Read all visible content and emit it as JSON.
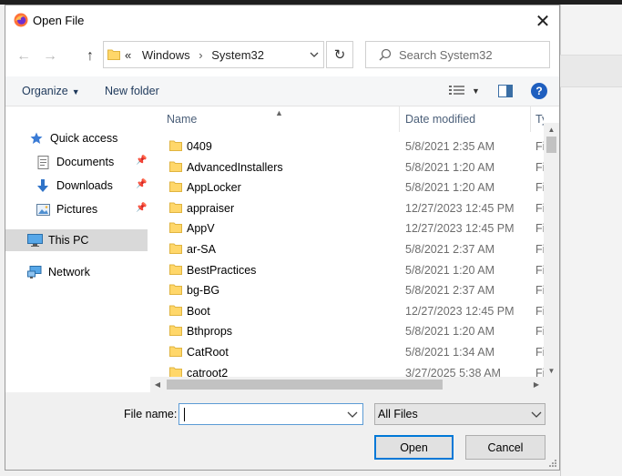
{
  "window": {
    "title": "Open File",
    "close_label": "✕"
  },
  "nav": {
    "back_label": "←",
    "forward_label": "→",
    "up_label": "↑",
    "address_prefix": "«",
    "address_parts": [
      "Windows",
      "System32"
    ],
    "address_separator": "›",
    "refresh_label": "↻",
    "search_placeholder": "Search System32"
  },
  "toolbar": {
    "organize_label": "Organize",
    "new_folder_label": "New folder",
    "help_label": "?"
  },
  "sidebar": {
    "items": [
      {
        "label": "Quick access",
        "icon": "star-icon"
      },
      {
        "label": "Documents",
        "icon": "document-icon",
        "pinned": true
      },
      {
        "label": "Downloads",
        "icon": "download-icon",
        "pinned": true
      },
      {
        "label": "Pictures",
        "icon": "pictures-icon",
        "pinned": true
      },
      {
        "label": "This PC",
        "icon": "computer-icon",
        "selected": true
      },
      {
        "label": "Network",
        "icon": "network-icon"
      }
    ]
  },
  "columns": {
    "name": "Name",
    "date_modified": "Date modified",
    "type": "Ty"
  },
  "files": [
    {
      "name": "0409",
      "date": "5/8/2021 2:35 AM",
      "type": "Fi"
    },
    {
      "name": "AdvancedInstallers",
      "date": "5/8/2021 1:20 AM",
      "type": "Fi"
    },
    {
      "name": "AppLocker",
      "date": "5/8/2021 1:20 AM",
      "type": "Fi"
    },
    {
      "name": "appraiser",
      "date": "12/27/2023 12:45 PM",
      "type": "Fi"
    },
    {
      "name": "AppV",
      "date": "12/27/2023 12:45 PM",
      "type": "Fi"
    },
    {
      "name": "ar-SA",
      "date": "5/8/2021 2:37 AM",
      "type": "Fi"
    },
    {
      "name": "BestPractices",
      "date": "5/8/2021 1:20 AM",
      "type": "Fi"
    },
    {
      "name": "bg-BG",
      "date": "5/8/2021 2:37 AM",
      "type": "Fi"
    },
    {
      "name": "Boot",
      "date": "12/27/2023 12:45 PM",
      "type": "Fi"
    },
    {
      "name": "Bthprops",
      "date": "5/8/2021 1:20 AM",
      "type": "Fi"
    },
    {
      "name": "CatRoot",
      "date": "5/8/2021 1:34 AM",
      "type": "Fi"
    },
    {
      "name": "catroot2",
      "date": "3/27/2025 5:38 AM",
      "type": "Fi"
    }
  ],
  "footer": {
    "file_name_label": "File name:",
    "file_name_value": "",
    "file_type_value": "All Files",
    "open_label": "Open",
    "cancel_label": "Cancel"
  },
  "colors": {
    "folder_yellow": "#ffd76a",
    "accent_blue": "#0078d7",
    "selection_gray": "#d9d9d9"
  }
}
